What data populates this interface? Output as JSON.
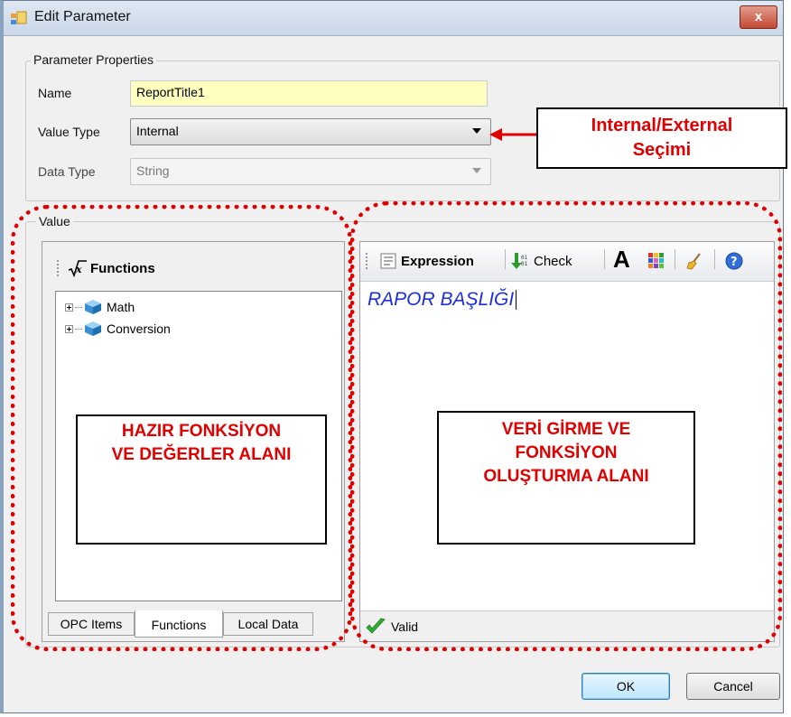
{
  "window": {
    "title": "Edit Parameter",
    "close_label": "x"
  },
  "parameter_properties": {
    "group_label": "Parameter Properties",
    "name_label": "Name",
    "name_value": "ReportTitle1",
    "value_type_label": "Value Type",
    "value_type_value": "Internal",
    "data_type_label": "Data Type",
    "data_type_value": "String"
  },
  "annotations": {
    "value_type_note_line1": "Internal/External",
    "value_type_note_line2": "Seçimi",
    "functions_area_line1": "HAZIR FONKSİYON",
    "functions_area_line2": "VE DEĞERLER ALANI",
    "editor_area_line1": "VERİ GİRME VE",
    "editor_area_line2": "FONKSİYON",
    "editor_area_line3": "OLUŞTURMA ALANI",
    "accent_color": "#e00000"
  },
  "value_group": {
    "label": "Value",
    "functions_panel": {
      "header": "Functions",
      "tree": [
        {
          "label": "Math"
        },
        {
          "label": "Conversion"
        }
      ],
      "tabs": [
        "OPC Items",
        "Functions",
        "Local Data"
      ],
      "active_tab": "Functions"
    },
    "expression_panel": {
      "toolbar": {
        "expression_label": "Expression",
        "check_label": "Check"
      },
      "expression_text": "RAPOR BAŞLIĞI",
      "status_text": "Valid"
    }
  },
  "buttons": {
    "ok": "OK",
    "cancel": "Cancel"
  }
}
